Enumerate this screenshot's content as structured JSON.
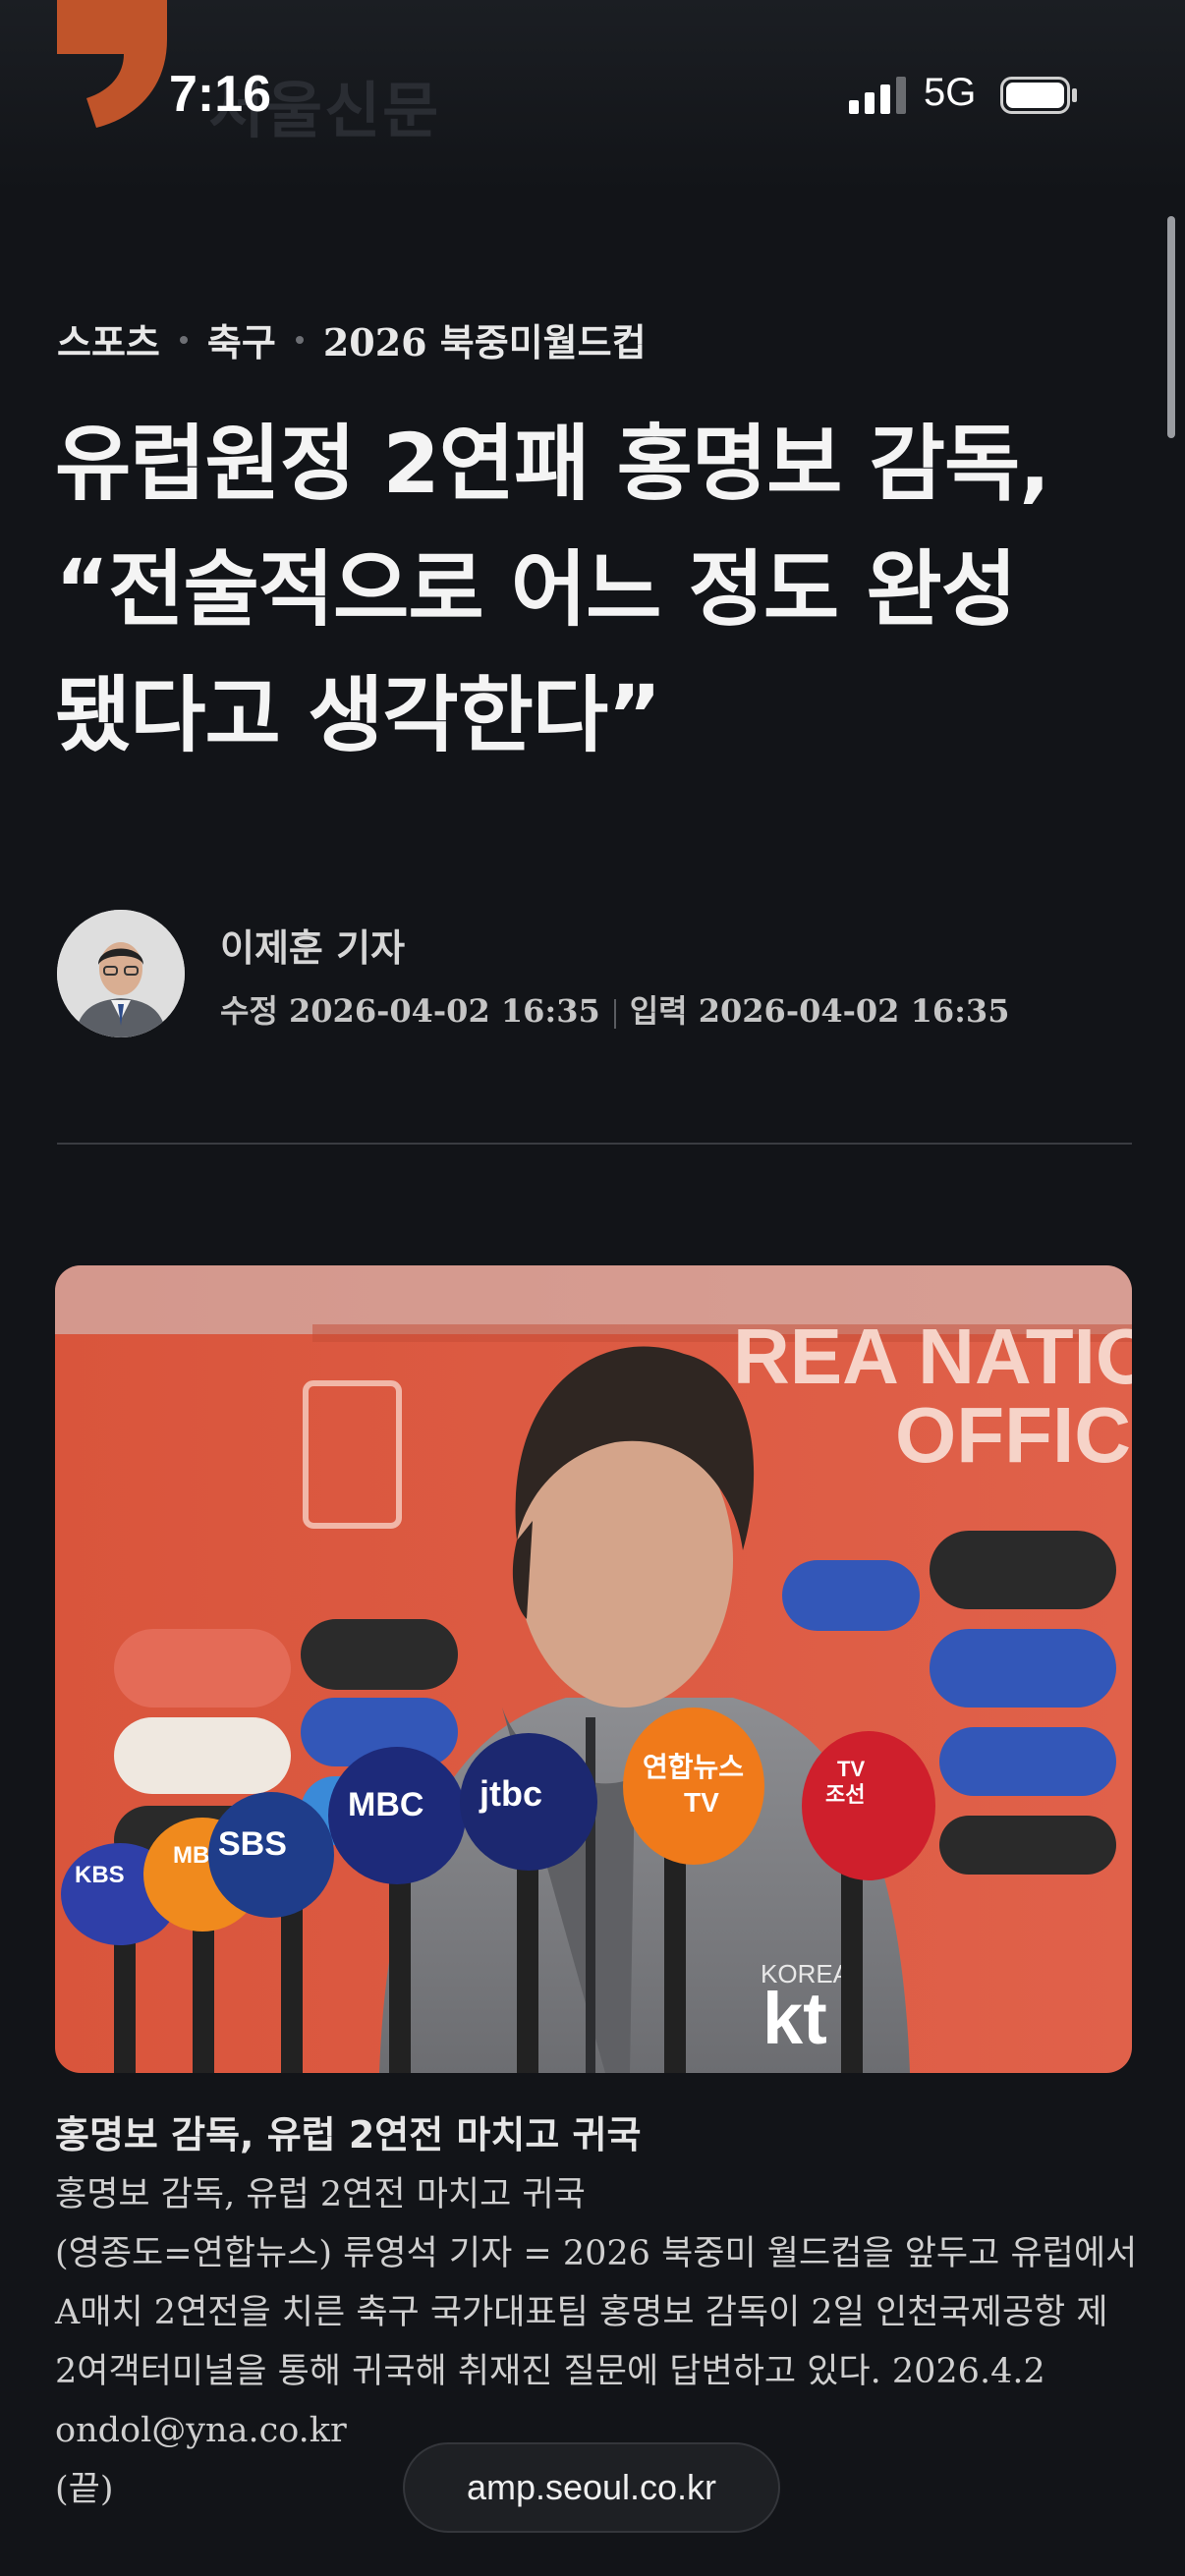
{
  "status_bar": {
    "time": "7:16",
    "network": "5G",
    "icons": [
      "signal-icon",
      "battery-icon"
    ]
  },
  "site": {
    "logo_text": "서울신문",
    "accent": "#c0542a"
  },
  "breadcrumb": {
    "items": [
      "스포츠",
      "축구",
      "2026 북중미월드컵"
    ]
  },
  "article": {
    "headline_lines": [
      "유럽원정 2연패 홍명보 감독,",
      "“전술적으로 어느 정도 완성",
      "됐다고 생각한다”"
    ],
    "author": "이제훈 기자",
    "modified": "수정 2026-04-02 16:35",
    "published": "입력 2026-04-02 16:35"
  },
  "photo": {
    "alt_icon": "press-conference-photo",
    "backdrop_text": [
      "REA NATIO",
      "OFFICI"
    ],
    "mic_labels": [
      "KBS",
      "MBN",
      "SBS",
      "MBC",
      "jtbc",
      "연합뉴스TV",
      "TV조선"
    ],
    "jacket_text": [
      "KOREA",
      "kt"
    ]
  },
  "caption": {
    "title": "홍명보 감독, 유럽 2연전 마치고 귀국",
    "lines": [
      "홍명보 감독, 유럽 2연전 마치고 귀국",
      "(영종도=연합뉴스) 류영석 기자 = 2026 북중미 월드컵을 앞두고 유럽에서",
      "A매치 2연전을 치른 축구 국가대표팀 홍명보 감독이 2일 인천국제공항 제",
      "2여객터미널을 통해 귀국해 취재진 질문에 답변하고 있다. 2026.4.2",
      "ondol@yna.co.kr",
      "(끝)"
    ]
  },
  "browser": {
    "url": "amp.seoul.co.kr"
  }
}
